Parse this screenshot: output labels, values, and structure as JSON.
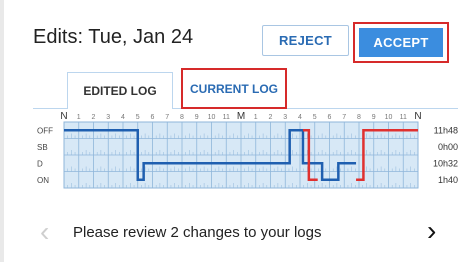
{
  "header": {
    "title": "Edits: Tue, Jan 24"
  },
  "actions": {
    "reject_label": "REJECT",
    "accept_label": "ACCEPT"
  },
  "tabs": [
    {
      "label": "EDITED LOG",
      "active": true
    },
    {
      "label": "CURRENT LOG",
      "active": false
    }
  ],
  "log_graph": {
    "hour_labels": [
      "N",
      "1",
      "2",
      "3",
      "4",
      "5",
      "6",
      "7",
      "8",
      "9",
      "10",
      "11",
      "M",
      "1",
      "2",
      "3",
      "4",
      "5",
      "6",
      "7",
      "8",
      "9",
      "10",
      "11",
      "N"
    ],
    "status_rows": [
      "OFF",
      "SB",
      "D",
      "ON"
    ],
    "totals": [
      "11h48",
      "0h00",
      "10h32",
      "1h40"
    ],
    "colors": {
      "edited": "#1f5fb0",
      "current": "#e0302f",
      "grid_bg": "#d7e8f6"
    }
  },
  "review": {
    "message": "Please review 2 changes to your logs"
  },
  "nav": {
    "prev_icon": "chevron-left-icon",
    "next_icon": "chevron-right-icon"
  }
}
